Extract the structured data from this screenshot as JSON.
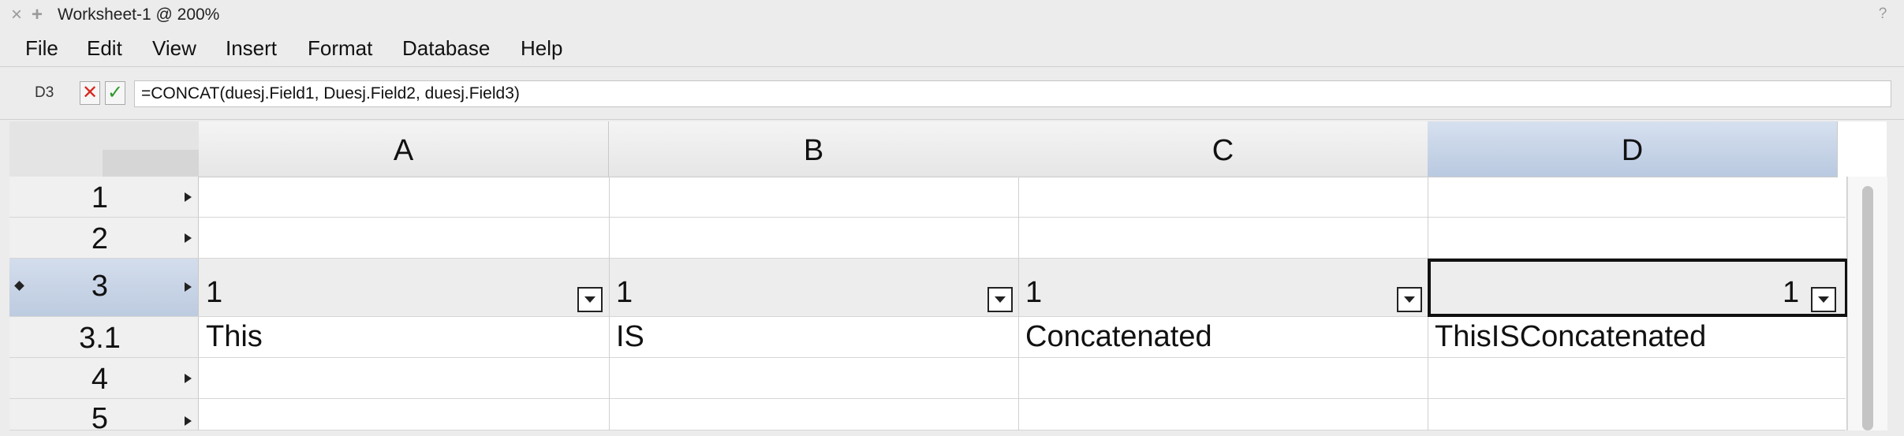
{
  "window": {
    "title": "Worksheet-1 @ 200%",
    "help": "?"
  },
  "menu": [
    "File",
    "Edit",
    "View",
    "Insert",
    "Format",
    "Database",
    "Help"
  ],
  "formula_bar": {
    "cell_ref": "D3",
    "formula": "=CONCAT(duesj.Field1, Duesj.Field2, duesj.Field3)"
  },
  "columns": [
    "A",
    "B",
    "C",
    "D"
  ],
  "selected_column": "D",
  "rows": [
    {
      "label": "1",
      "cells": [
        "",
        "",
        "",
        ""
      ]
    },
    {
      "label": "2",
      "cells": [
        "",
        "",
        "",
        ""
      ]
    },
    {
      "label": "3",
      "cells": [
        "1",
        "1",
        "1",
        "1"
      ]
    },
    {
      "label": "3.1",
      "cells": [
        "This",
        "IS",
        "Concatenated",
        "ThisISConcatenated"
      ]
    },
    {
      "label": "4",
      "cells": [
        "",
        "",
        "",
        ""
      ]
    },
    {
      "label": "5",
      "cells": [
        "",
        "",
        "",
        ""
      ]
    }
  ],
  "active_cell": "D3",
  "colors": {
    "selection": "#bdcbe0",
    "cancel": "#d9261c",
    "accept": "#2d9a2d"
  }
}
